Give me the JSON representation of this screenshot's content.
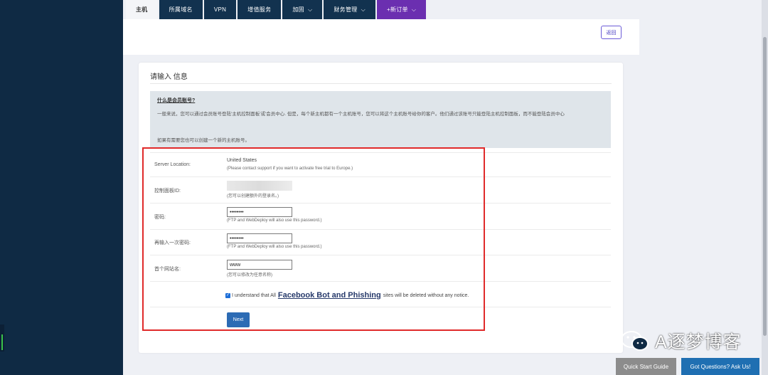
{
  "nav": {
    "tabs": [
      {
        "label": "主机",
        "active": true
      },
      {
        "label": "所属域名"
      },
      {
        "label": "VPN"
      },
      {
        "label": "增值服务"
      },
      {
        "label": "加固",
        "dropdown": true
      },
      {
        "label": "财务管理",
        "dropdown": true
      },
      {
        "label": "+新订单",
        "dropdown": true
      }
    ]
  },
  "header": {
    "back_label": "返回"
  },
  "card": {
    "title": "请输入 信息",
    "info": {
      "heading": "什么是会员账号?",
      "paragraph1": "一般来说，您可以通过会员账号登陆'主机控制面板'或'会员中心. 但是，每个新主机都有一个主机账号，您可以将这个主机账号给你的客户。他们通过该账号只能登陆主机控制面板，而不能登陆会员中心",
      "paragraph2": "如果有需要您也可以创建一个新的主机账号。"
    },
    "form": {
      "server_location_label": "Server Location:",
      "server_location_value": "United States",
      "server_location_help": "(Please contact support if you want to activate free trial to Europe.)",
      "panel_id_label": "控制面板ID:",
      "panel_id_help": "(您可以创建额外的登录名。)",
      "password_label": "密码:",
      "password_value": "••••••••",
      "password_help": "(FTP and WebDeploy will also use this password.)",
      "password2_label": "再输入一次密码:",
      "password2_value": "••••••••",
      "password2_help": "(FTP and WebDeploy will also use this password.)",
      "site_label": "首个网站名:",
      "site_value": "www",
      "site_help": "(您可以修改为任意名称)",
      "agree_prefix": "I understand that All",
      "agree_link": "Facebook Bot and Phishing",
      "agree_suffix": "sites will be deleted without any notice.",
      "next_label": "Next"
    }
  },
  "watermark": {
    "text": "A逐梦博客"
  },
  "footer": {
    "quick_start": "Quick Start Guide",
    "ask": "Got Questions? Ask Us!"
  },
  "colors": {
    "accent": "#6b2fb0",
    "nav_bg": "#12324f",
    "button": "#2c6bb4",
    "highlight": "#e02a2a"
  }
}
